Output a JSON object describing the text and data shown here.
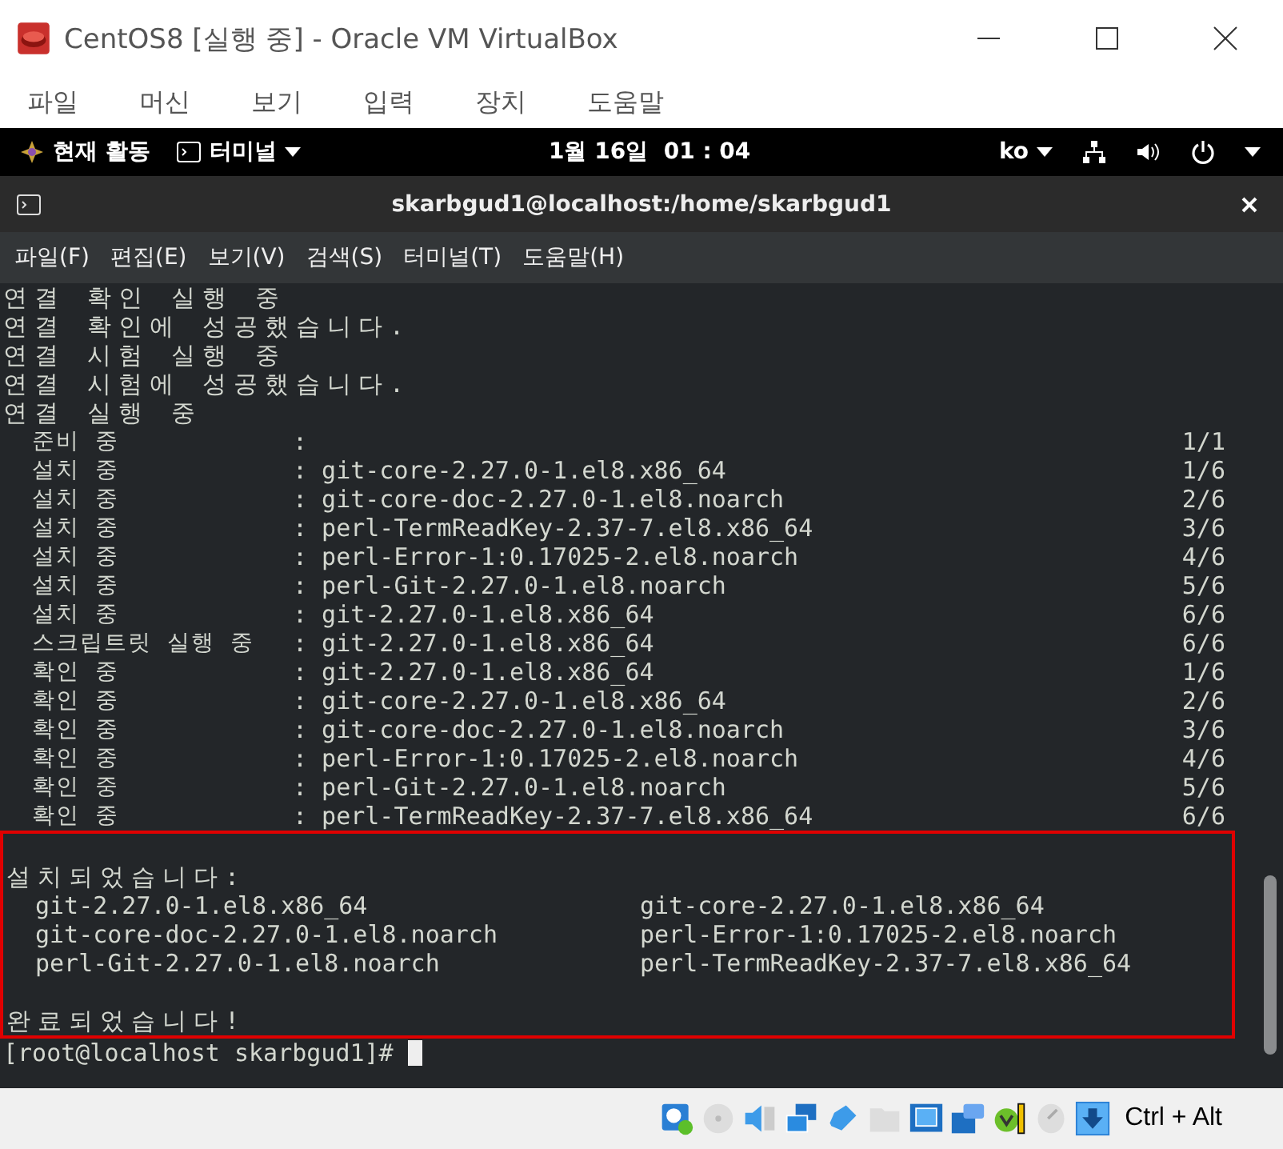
{
  "window": {
    "title": "CentOS8 [실행 중] - Oracle VM VirtualBox"
  },
  "menu": [
    "파일",
    "머신",
    "보기",
    "입력",
    "장치",
    "도움말"
  ],
  "top_bar": {
    "activities": "현재 활동",
    "app_menu": "터미널",
    "clock": "1월 16일  01 : 04",
    "language": "ko"
  },
  "terminal": {
    "title": "skarbgud1@localhost:/home/skarbgud1",
    "menu": [
      "파일(F)",
      "편집(E)",
      "보기(V)",
      "검색(S)",
      "터미널(T)",
      "도움말(H)"
    ],
    "lines": [
      "연결 확인 실행 중",
      "연결 확인에 성공했습니다.",
      "연결 시험 실행 중",
      "연결 시험에 성공했습니다.",
      "연결 실행 중"
    ],
    "rows": [
      {
        "action": "준비 중",
        "package": ":",
        "count": "1/1"
      },
      {
        "action": "설치 중",
        "package": ": git-core-2.27.0-1.el8.x86_64",
        "count": "1/6"
      },
      {
        "action": "설치 중",
        "package": ": git-core-doc-2.27.0-1.el8.noarch",
        "count": "2/6"
      },
      {
        "action": "설치 중",
        "package": ": perl-TermReadKey-2.37-7.el8.x86_64",
        "count": "3/6"
      },
      {
        "action": "설치 중",
        "package": ": perl-Error-1:0.17025-2.el8.noarch",
        "count": "4/6"
      },
      {
        "action": "설치 중",
        "package": ": perl-Git-2.27.0-1.el8.noarch",
        "count": "5/6"
      },
      {
        "action": "설치 중",
        "package": ": git-2.27.0-1.el8.x86_64",
        "count": "6/6"
      },
      {
        "action": "스크립트릿 실행 중",
        "package": ": git-2.27.0-1.el8.x86_64",
        "count": "6/6"
      },
      {
        "action": "확인 중",
        "package": ": git-2.27.0-1.el8.x86_64",
        "count": "1/6"
      },
      {
        "action": "확인 중",
        "package": ": git-core-2.27.0-1.el8.x86_64",
        "count": "2/6"
      },
      {
        "action": "확인 중",
        "package": ": git-core-doc-2.27.0-1.el8.noarch",
        "count": "3/6"
      },
      {
        "action": "확인 중",
        "package": ": perl-Error-1:0.17025-2.el8.noarch",
        "count": "4/6"
      },
      {
        "action": "확인 중",
        "package": ": perl-Git-2.27.0-1.el8.noarch",
        "count": "5/6"
      },
      {
        "action": "확인 중",
        "package": ": perl-TermReadKey-2.37-7.el8.x86_64",
        "count": "6/6"
      }
    ],
    "installed_heading": "설치되었습니다:",
    "installed": [
      "git-2.27.0-1.el8.x86_64",
      "git-core-2.27.0-1.el8.x86_64",
      "git-core-doc-2.27.0-1.el8.noarch",
      "perl-Error-1:0.17025-2.el8.noarch",
      "perl-Git-2.27.0-1.el8.noarch",
      "perl-TermReadKey-2.37-7.el8.x86_64"
    ],
    "done": "완료되었습니다!",
    "prompt": "[root@localhost skarbgud1]#"
  },
  "status_bar": {
    "host_key": "Ctrl + Alt"
  }
}
